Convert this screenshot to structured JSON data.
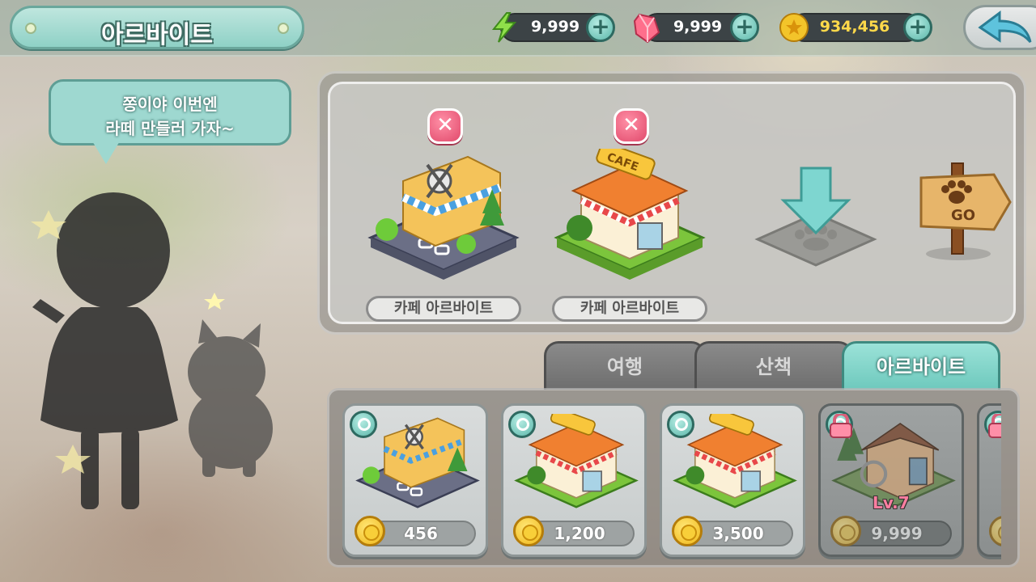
{
  "header": {
    "title": "아르바이트",
    "energy": "9,999",
    "gems": "9,999",
    "coins": "934,456"
  },
  "speech": {
    "line1": "쫑이야 이번엔",
    "line2": "라떼 만들러 가자~"
  },
  "slots": [
    {
      "label": "카페 아르바이트",
      "building": "scissors-shop-icon"
    },
    {
      "label": "카페 아르바이트",
      "building": "cafe-icon"
    }
  ],
  "slot_extra": {
    "drop_target": "down-arrow-pawprint-icon",
    "go_sign": "GO"
  },
  "tabs": [
    {
      "label": "여행",
      "active": false
    },
    {
      "label": "산책",
      "active": false
    },
    {
      "label": "아르바이트",
      "active": true
    }
  ],
  "cards": [
    {
      "price": "456",
      "building": "scissors-shop-icon",
      "locked": false
    },
    {
      "price": "1,200",
      "building": "cafe-icon",
      "locked": false
    },
    {
      "price": "3,500",
      "building": "cafe-icon",
      "locked": false
    },
    {
      "price": "9,999",
      "building": "house-icon",
      "locked": true,
      "level": "Lv.7"
    }
  ],
  "colors": {
    "accent": "#6ec9bd",
    "close": "#e14a6c",
    "coin": "#f0b81a",
    "level": "#ff7ea0"
  }
}
